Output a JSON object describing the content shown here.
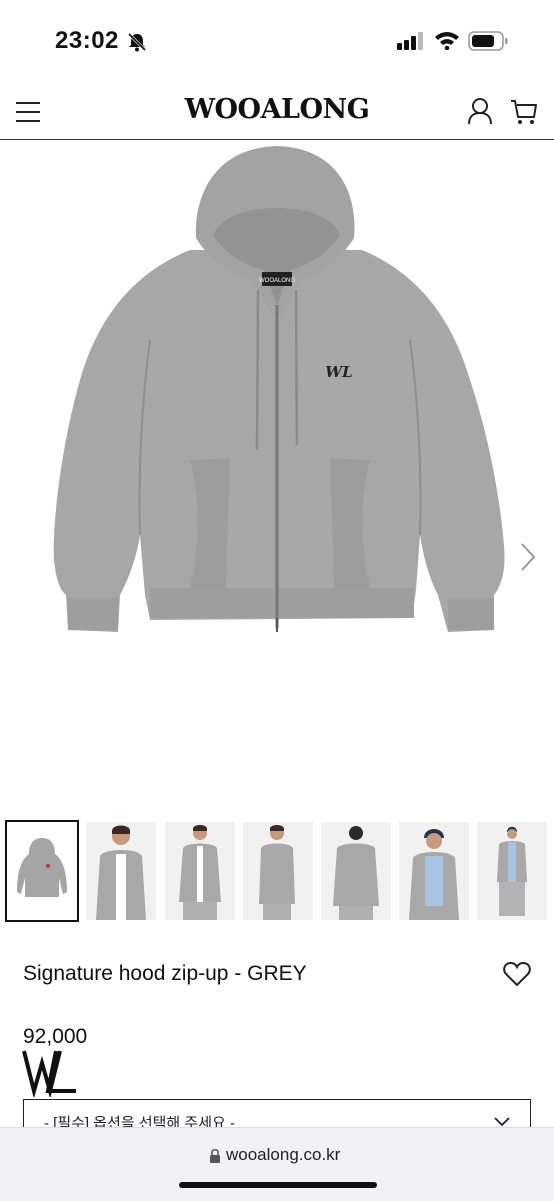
{
  "status_bar": {
    "time": "23:02"
  },
  "header": {
    "brand": "WOOALONG"
  },
  "product": {
    "name": "Signature hood zip-up - GREY",
    "price": "92,000",
    "neck_label": "WOOALONG",
    "chest_logo": "WL"
  },
  "option_select": {
    "placeholder": "- [필수] 옵션을 선택해 주세요 -"
  },
  "thumbnails": [
    {
      "kind": "product",
      "selected": true
    },
    {
      "kind": "model-front"
    },
    {
      "kind": "model-front-pants"
    },
    {
      "kind": "model-side"
    },
    {
      "kind": "model-back"
    },
    {
      "kind": "model-beanie"
    },
    {
      "kind": "model-full"
    }
  ],
  "browser": {
    "url": "wooalong.co.kr"
  },
  "colors": {
    "hoodie": "#a7a7a7",
    "hoodie_shadow": "#8e8e8e",
    "text": "#111111"
  }
}
